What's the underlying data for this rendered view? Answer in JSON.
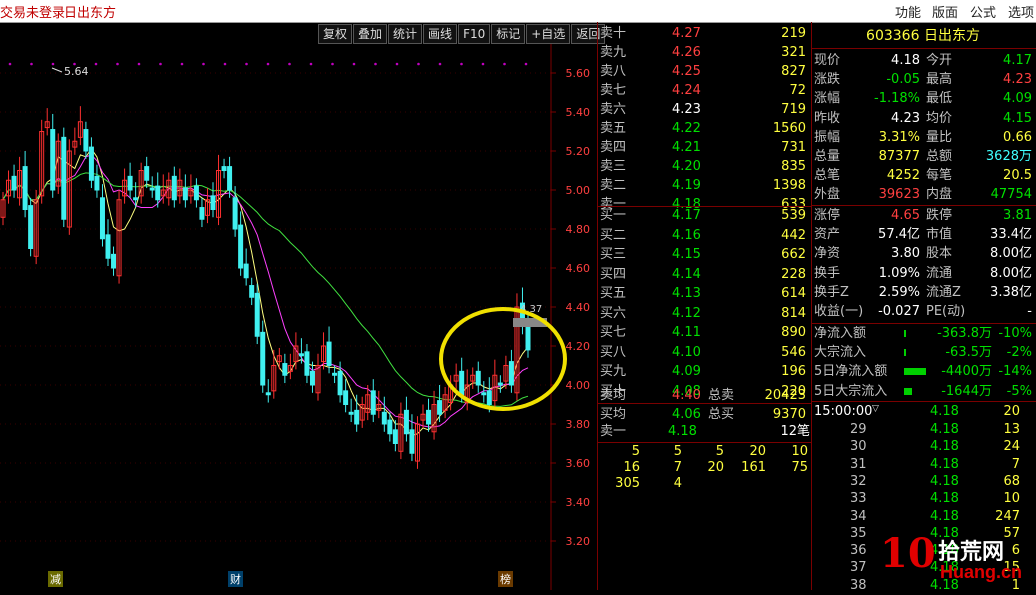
{
  "topbar": {
    "status": "交易未登录",
    "stock_name": "日出东方",
    "menus": [
      "功能",
      "版面",
      "公式",
      "选项"
    ]
  },
  "toolbar": {
    "buttons": [
      "复权",
      "叠加",
      "统计",
      "画线",
      "F10",
      "标记",
      "+自选",
      "返回"
    ]
  },
  "chart": {
    "high_label": "5.64",
    "price_axis": [
      "5.60",
      "5.40",
      "5.20",
      "5.00",
      "4.80",
      "4.60",
      "4.40",
      "4.20",
      "4.00",
      "3.80",
      "3.60",
      "3.40",
      "3.20"
    ],
    "bottom_markers": [
      "减",
      "财",
      "榜"
    ],
    "annotation": "4.37"
  },
  "order_book": {
    "sell": [
      {
        "label": "卖十",
        "price": "4.27",
        "vol": "219"
      },
      {
        "label": "卖九",
        "price": "4.26",
        "vol": "321"
      },
      {
        "label": "卖八",
        "price": "4.25",
        "vol": "827"
      },
      {
        "label": "卖七",
        "price": "4.24",
        "vol": "72"
      },
      {
        "label": "卖六",
        "price": "4.23",
        "vol": "719"
      },
      {
        "label": "卖五",
        "price": "4.22",
        "vol": "1560"
      },
      {
        "label": "卖四",
        "price": "4.21",
        "vol": "731"
      },
      {
        "label": "卖三",
        "price": "4.20",
        "vol": "835"
      },
      {
        "label": "卖二",
        "price": "4.19",
        "vol": "1398"
      },
      {
        "label": "卖一",
        "price": "4.18",
        "vol": "633"
      }
    ],
    "buy": [
      {
        "label": "买一",
        "price": "4.17",
        "vol": "539"
      },
      {
        "label": "买二",
        "price": "4.16",
        "vol": "442"
      },
      {
        "label": "买三",
        "price": "4.15",
        "vol": "662"
      },
      {
        "label": "买四",
        "price": "4.14",
        "vol": "228"
      },
      {
        "label": "买五",
        "price": "4.13",
        "vol": "614"
      },
      {
        "label": "买六",
        "price": "4.12",
        "vol": "814"
      },
      {
        "label": "买七",
        "price": "4.11",
        "vol": "890"
      },
      {
        "label": "买八",
        "price": "4.10",
        "vol": "546"
      },
      {
        "label": "买九",
        "price": "4.09",
        "vol": "196"
      },
      {
        "label": "买十",
        "price": "4.08",
        "vol": "220"
      }
    ],
    "avg": [
      {
        "label": "卖均",
        "price": "4.40",
        "tlabel": "总卖",
        "tval": "20423"
      },
      {
        "label": "买均",
        "price": "4.06",
        "tlabel": "总买",
        "tval": "9370"
      }
    ],
    "sell1": {
      "label": "卖一",
      "price": "4.18",
      "count": "12笔"
    },
    "queue": [
      [
        "5",
        "5",
        "5",
        "20",
        "10"
      ],
      [
        "16",
        "7",
        "20",
        "161",
        "75"
      ],
      [
        "305",
        "4",
        "",
        "",
        ""
      ]
    ]
  },
  "info": {
    "code": "603366",
    "name": "日出东方",
    "rows1": [
      [
        "现价",
        "4.18",
        "今开",
        "4.17"
      ],
      [
        "涨跌",
        "-0.05",
        "最高",
        "4.23"
      ],
      [
        "涨幅",
        "-1.18%",
        "最低",
        "4.09"
      ],
      [
        "昨收",
        "4.23",
        "均价",
        "4.15"
      ],
      [
        "振幅",
        "3.31%",
        "量比",
        "0.66"
      ],
      [
        "总量",
        "87377",
        "总额",
        "3628万"
      ],
      [
        "总笔",
        "4252",
        "每笔",
        "20.5"
      ],
      [
        "外盘",
        "39623",
        "内盘",
        "47754"
      ]
    ],
    "rows2": [
      [
        "涨停",
        "4.65",
        "跌停",
        "3.81"
      ],
      [
        "资产",
        "57.4亿",
        "市值",
        "33.4亿"
      ],
      [
        "净资",
        "3.80",
        "股本",
        "8.00亿"
      ],
      [
        "换手",
        "1.09%",
        "流通",
        "8.00亿"
      ],
      [
        "换手Z",
        "2.59%",
        "流通Z",
        "3.38亿"
      ],
      [
        "收益(一)",
        "-0.027",
        "PE(动)",
        "-"
      ]
    ],
    "flows": [
      [
        "净流入额",
        "-363.8万",
        "-10%"
      ],
      [
        "大宗流入",
        "-63.5万",
        "-2%"
      ],
      [
        "5日净流入额",
        "-4400万",
        "-14%"
      ],
      [
        "5日大宗流入",
        "-1644万",
        "-5%"
      ]
    ]
  },
  "ticks": {
    "header_time": "15:00:00",
    "first": {
      "price": "4.18",
      "vol": "20"
    },
    "rows": [
      [
        "29",
        "4.18",
        "13"
      ],
      [
        "30",
        "4.18",
        "24"
      ],
      [
        "31",
        "4.18",
        "7"
      ],
      [
        "32",
        "4.18",
        "68"
      ],
      [
        "33",
        "4.18",
        "10"
      ],
      [
        "34",
        "4.18",
        "247"
      ],
      [
        "35",
        "4.18",
        "57"
      ],
      [
        "36",
        "4.18",
        "6"
      ],
      [
        "37",
        "4.18",
        "15"
      ],
      [
        "38",
        "4.18",
        "1"
      ]
    ]
  },
  "watermark": {
    "num": "10",
    "text1": "拾荒网",
    "text2": "Huang.cn"
  }
}
